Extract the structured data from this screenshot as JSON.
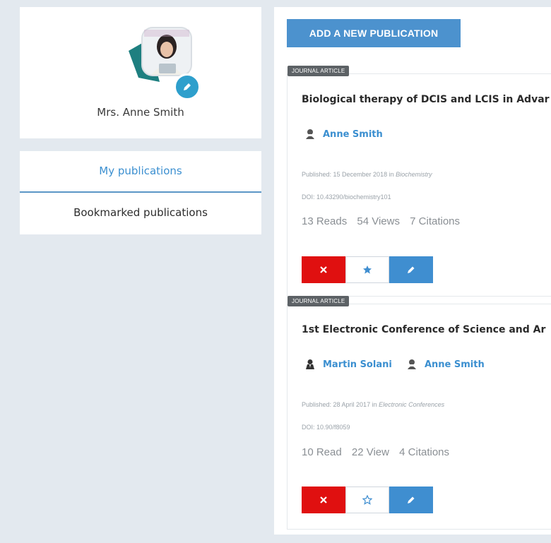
{
  "profile": {
    "name": "Mrs. Anne Smith",
    "avatar_icon": "user-photo",
    "edit_icon": "pencil-icon"
  },
  "nav": {
    "items": [
      {
        "label": "My publications",
        "active": true
      },
      {
        "label": "Bookmarked publications",
        "active": false
      }
    ]
  },
  "toolbar": {
    "add_label": "ADD A NEW PUBLICATION"
  },
  "publications": [
    {
      "type": "JOURNAL ARTICLE",
      "title": "Biological therapy of DCIS and LCIS in Advar",
      "authors": [
        "Anne Smith"
      ],
      "published_prefix": "Published: 15 December 2018 in ",
      "published_venue": "Biochemistry",
      "doi": "DOI: 10.43290/biochemistry101",
      "reads": "13 Reads",
      "views": "54 Views",
      "citations": "7 Citations",
      "bookmarked": true
    },
    {
      "type": "JOURNAL ARTICLE",
      "title": "1st Electronic Conference of Science and Ar",
      "authors": [
        "Martin Solani",
        "Anne Smith"
      ],
      "published_prefix": "Published: 28 April 2017 in ",
      "published_venue": "Electronic Conferences",
      "doi": "DOI: 10.90/f8059",
      "reads": "10 Read",
      "views": "22 View",
      "citations": "4 Citations",
      "bookmarked": false
    }
  ],
  "colors": {
    "accent": "#4c92ce",
    "delete": "#e01010",
    "background": "#e3e9ef"
  }
}
